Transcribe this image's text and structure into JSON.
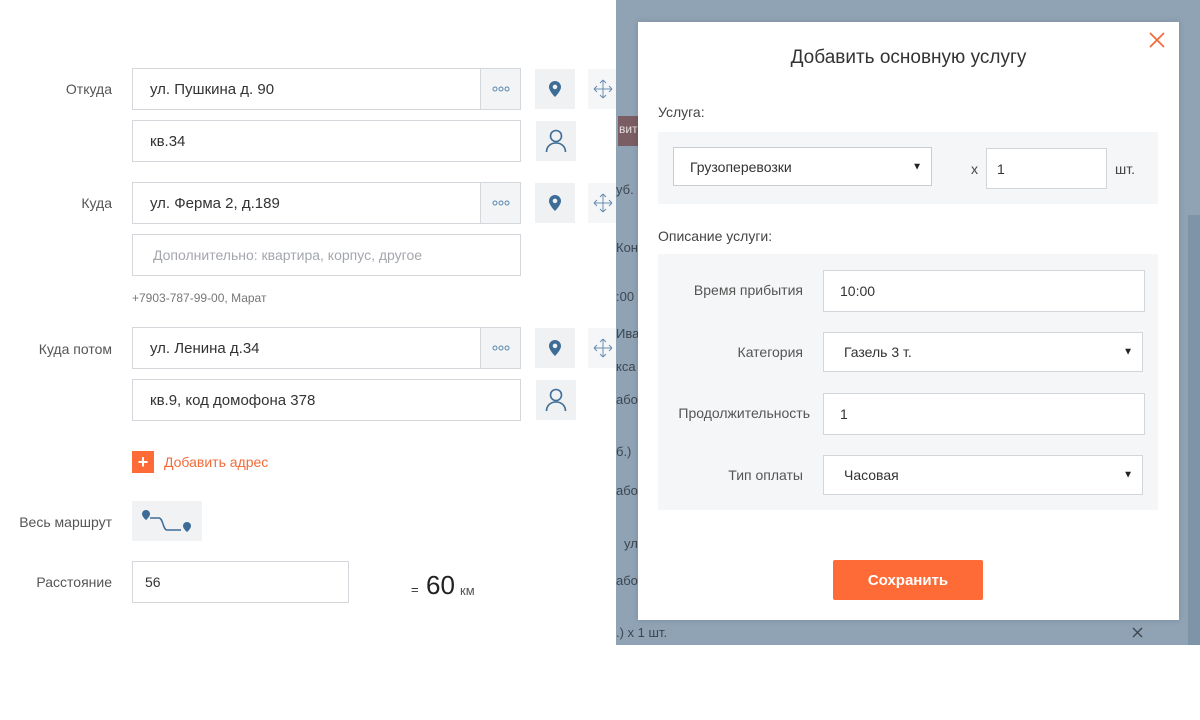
{
  "form": {
    "from": {
      "label": "Откуда",
      "address": "ул. Пушкина д. 90",
      "extra": "кв.34"
    },
    "to": {
      "label": "Куда",
      "address": "ул. Ферма 2, д.189",
      "extra_placeholder": "Дополнительно: квартира, корпус, другое",
      "contact": "+7903-787-99-00, Марат"
    },
    "then": {
      "label": "Куда потом",
      "address": "ул. Ленина д.34",
      "extra": "кв.9, код домофона 378"
    },
    "add_address": "Добавить адрес",
    "route_label": "Весь маршрут",
    "distance_label": "Расстояние",
    "distance_value": "56",
    "equals": "=",
    "distance_result": "60",
    "distance_unit": "км"
  },
  "background": {
    "fragments": [
      "вит",
      "уб.",
      "Кон",
      ":00",
      "Ива",
      "кса",
      "або",
      "б.)",
      "або",
      "ул",
      "або"
    ],
    "bottom_text": ".)   x 1 шт."
  },
  "modal": {
    "title": "Добавить основную услугу",
    "service_label": "Услуга:",
    "service_value": "Грузоперевозки",
    "multiplier": "x",
    "quantity": "1",
    "quantity_unit": "шт.",
    "description_label": "Описание услуги:",
    "rows": [
      {
        "label": "Время прибытия",
        "value": "10:00",
        "kind": "input"
      },
      {
        "label": "Категория",
        "value": "Газель 3 т.",
        "kind": "select"
      },
      {
        "label": "Продолжительность",
        "value": "1",
        "kind": "input"
      },
      {
        "label": "Тип оплаты",
        "value": "Часовая",
        "kind": "select"
      }
    ],
    "save_label": "Сохранить"
  },
  "colors": {
    "accent": "#ff6b36",
    "icon_blue": "#3d6d96",
    "overlay": "#8fa3b5"
  },
  "icons": [
    "ellipsis-icon",
    "map-pin-icon",
    "move-icon",
    "person-icon",
    "plus-icon",
    "route-icon",
    "close-icon",
    "caret-down-icon"
  ]
}
